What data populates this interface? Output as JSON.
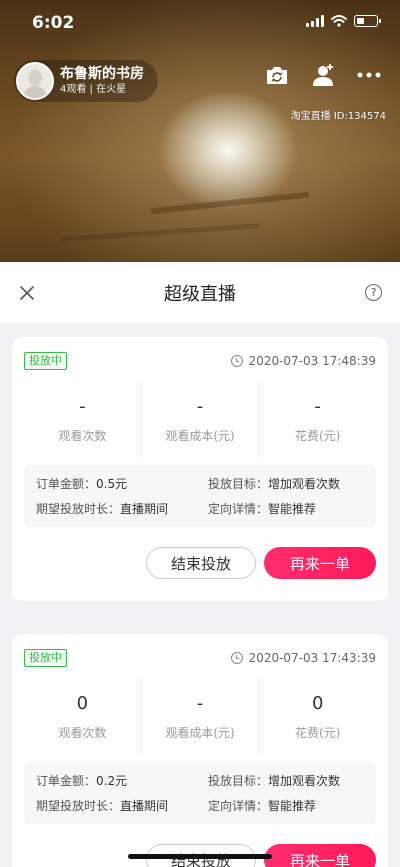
{
  "status_bar": {
    "time": "6:02"
  },
  "host": {
    "name": "布鲁斯的书房",
    "subtitle": "4观看 | 在火星"
  },
  "live_id": "淘宝直播 ID:134574",
  "panel": {
    "title": "超级直播",
    "help_glyph": "?"
  },
  "orders": [
    {
      "status": "投放中",
      "time": "2020-07-03 17:48:39",
      "stats": [
        {
          "value": "-",
          "label": "观看次数"
        },
        {
          "value": "-",
          "label": "观看成本(元)"
        },
        {
          "value": "-",
          "label": "花费(元)"
        }
      ],
      "details": {
        "amount_label": "订单金额：",
        "amount": "0.5元",
        "target_label": "投放目标：",
        "target": "增加观看次数",
        "duration_label": "期望投放时长：",
        "duration": "直播期间",
        "targeting_label": "定向详情：",
        "targeting": "智能推荐"
      },
      "actions": {
        "stop": "结束投放",
        "reorder": "再来一单"
      }
    },
    {
      "status": "投放中",
      "time": "2020-07-03 17:43:39",
      "stats": [
        {
          "value": "0",
          "label": "观看次数"
        },
        {
          "value": "-",
          "label": "观看成本(元)"
        },
        {
          "value": "0",
          "label": "花费(元)"
        }
      ],
      "details": {
        "amount_label": "订单金额：",
        "amount": "0.2元",
        "target_label": "投放目标：",
        "target": "增加观看次数",
        "duration_label": "期望投放时长：",
        "duration": "直播期间",
        "targeting_label": "定向详情：",
        "targeting": "智能推荐"
      },
      "actions": {
        "stop": "结束投放",
        "reorder": "再来一单"
      }
    }
  ]
}
